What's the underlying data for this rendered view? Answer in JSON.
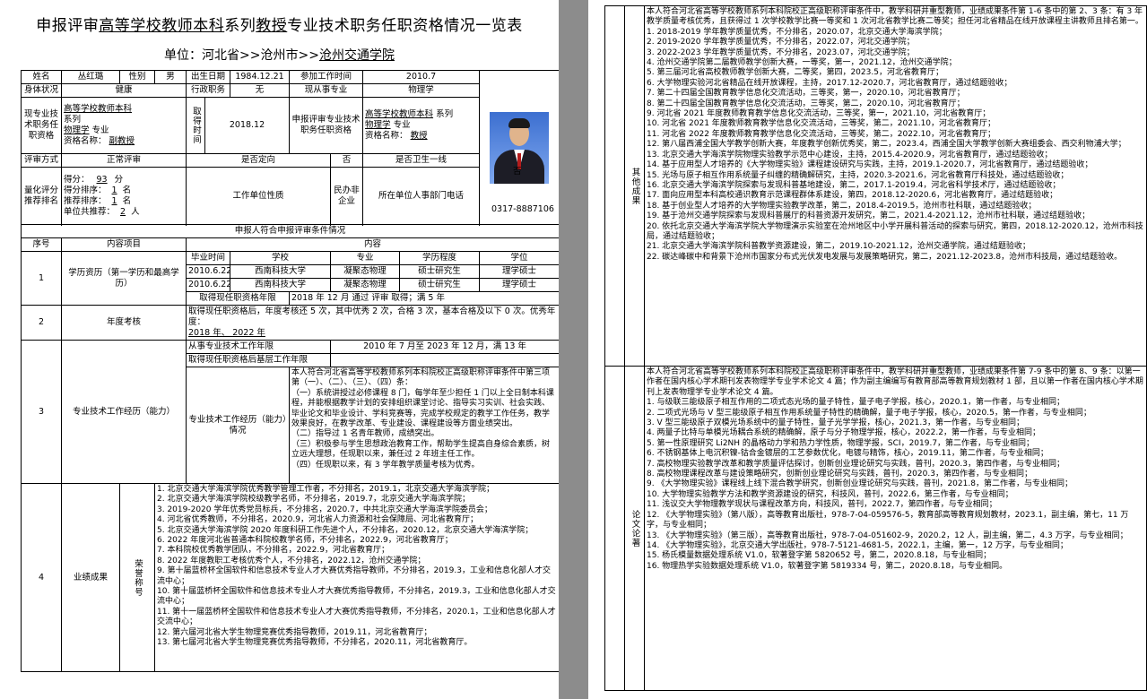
{
  "header": {
    "title_prefix": "申报评审",
    "title_field1": "高等学校教师本科",
    "title_mid1": "系列",
    "title_field2": "教授",
    "title_suffix": "专业技术职务任职资格情况一览表",
    "unit_label": "单位：河北省>>沧州市>>",
    "unit_name": "沧州交通学院"
  },
  "basic": {
    "name_label": "姓名",
    "name": "丛红璐",
    "sex_label": "性别",
    "sex": "男",
    "birth_label": "出生日期",
    "birth": "1984.12.21",
    "work_label": "参加工作时间",
    "work": "2010.7",
    "health_label": "身体状况",
    "health": "健康",
    "admin_label": "行政职务",
    "admin": "无",
    "major_label": "现从事专业",
    "major": "物理学",
    "cur_label": "现专业技术职务任职资格",
    "cur_line1": "高等学校教师本科",
    "cur_line2": "系列",
    "cur_line3a": "物理学",
    "cur_line3b": "专业",
    "cur_line4a": "资格名称：",
    "cur_line4b": "副教授",
    "get_label": "取得时间",
    "get_date": "2018.12",
    "apply_label": "申报评审专业技术职务任职资格",
    "apply_line1": "高等学校教师本科",
    "apply_line1b": "系列",
    "apply_line2a": "物理学",
    "apply_line2b": "专业",
    "apply_line3a": "资格名称：",
    "apply_line3b": "教授"
  },
  "review": {
    "way_label": "评审方式",
    "way": "正常评审",
    "directed_label": "是否定向",
    "directed": "否",
    "health_line_label": "是否卫生一线",
    "health_line": "否",
    "rank_label": "量化评分推荐排名",
    "score_label": "得分：",
    "score": "93",
    "score_unit": "分",
    "rank_label2": "得分排序：",
    "rank": "1",
    "rank_unit": "名",
    "rec_label": "推荐排序：",
    "rec": "1",
    "rec_unit": "名",
    "total_label": "单位共推荐：",
    "total": "2",
    "total_unit": "人",
    "nature_label": "工作单位性质",
    "nature": "民办非企业",
    "phone_label": "所在单位人事部门电话",
    "phone": "0317-8887106"
  },
  "cond": {
    "section_title": "申报人符合申报评审条件情况",
    "seq_label": "序号",
    "item_label": "内容项目",
    "content_label": "内容",
    "edu_seq": "1",
    "edu_label": "学历资历（第一学历和最高学历）",
    "edu_headers": [
      "毕业时间",
      "学校",
      "专业",
      "学历程度",
      "学位"
    ],
    "edu_rows": [
      [
        "2010.6.22",
        "西南科技大学",
        "凝聚态物理",
        "硕士研究生",
        "理学硕士"
      ],
      [
        "2010.6.22",
        "西南科技大学",
        "凝聚态物理",
        "硕士研究生",
        "理学硕士"
      ]
    ],
    "limit_label": "取得现任职资格年限",
    "limit_text": "2018 年 12 月   通过  评审  取得；满  5  年",
    "annual_seq": "2",
    "annual_label": "年度考核",
    "annual_text1": "取得现任职资格后，年度考核还 5 次，其中优秀 2 次，合格 3 次，基本合格及以下 0 次。优秀年度：",
    "annual_text2": "2018 年、  2022 年",
    "ability_seq": "3",
    "ability_label": "专业技术工作经历（能力）",
    "years_label": "从事专业技术工作年限",
    "years_text": "2010 年  7 月至  2023  年  12  月，满  13  年",
    "years2_label": "取得现任职资格后基层工作年限",
    "years2_text": "",
    "exp_label": "专业技术工作经历（能力）情况",
    "exp_text": [
      "本人符合河北省高等学校教师系列本科院校正高级职称评审条件中第三项第（一）、（二）、（三）、（四）条：",
      "（一）系统讲授过必修课程 8 门，每学年至少担任 1 门以上全日制本科课程，并能根据教学计划的安排组织课堂讨论、指导实习实训、社会实践、毕业论文和毕业设计、学科竞赛等，完成学校规定的教学工作任务，教学效果良好，在教学改革、专业建设、课程建设等方面业绩突出。",
      "（二）指导过 1 名青年教师，成绩突出。",
      "（三）积极参与学生思想政治教育工作，帮助学生提高自身综合素质，树立远大理想，任现职以来，兼任过 2 年班主任工作。",
      "（四）任现职以来，有 3 学年教学质量考核为优秀。"
    ],
    "perf_seq": "4",
    "perf_label": "业绩成果",
    "honor_label": "荣誉称号",
    "honors": [
      "1. 北京交通大学海滨学院优秀教学管理工作者，不分排名，2019.1，北京交通大学海滨学院；",
      "2. 北京交通大学海滨学院校级教学名师，不分排名，2019.7，北京交通大学海滨学院；",
      "3. 2019-2020 学年优秀党员标兵，不分排名，2020.7，中共北京交通大学海滨学院委员会；",
      "4. 河北省优秀教师，不分排名，2020.9，河北省人力资源和社会保障局、河北省教育厅；",
      "5. 北京交通大学海滨学院 2020 年度科研工作先进个人，不分排名，2020.12，北京交通大学海滨学院；",
      "6. 2022 年度河北省普通本科院校教学名师，不分排名，2022.9，河北省教育厅；",
      "7. 本科院校优秀教学团队，不分排名，2022.9，河北省教育厅；",
      "8. 2022 年度教职工考核优秀个人，不分排名，2022.12，沧州交通学院；",
      "9. 第十届蓝桥杯全国软件和信息技术专业人才大赛优秀指导教师，不分排名，2019.3，工业和信息化部人才交流中心；",
      "10. 第十届蓝桥杯全国软件和信息技术专业人才大赛优秀指导教师，不分排名，2019.3，工业和信息化部人才交流中心；",
      "11. 第十一届蓝桥杯全国软件和信息技术专业人才大赛优秀指导教师，不分排名，2020.1，工业和信息化部人才交流中心；",
      "12. 第六届河北省大学生物理竞赛优秀指导教师，2019.11，河北省教育厅；",
      "13. 第七届河北省大学生物理竞赛优秀指导教师，不分排名，2020.11，河北省教育厅。"
    ]
  },
  "right": {
    "other_label": "其他成果",
    "other": [
      "本人符合河北省高等学校教师系列本科院校正高级职称评审条件中，教学科研并重型教师，业绩成果条件第 1-6 条中的第 2、3 条：有 3 年教学质量考核优秀，且获得过 1 次学校教学比赛一等奖和 1 次河北省教学比赛二等奖；担任河北省精品在线开放课程主讲教师且排名第一。",
      "1. 2018-2019 学年教学质量优秀，不分排名，2020.07，北京交通大学海滨学院；",
      "2. 2019-2020 学年教学质量优秀，不分排名，2022.07，河北交通学院；",
      "3. 2022-2023 学年教学质量优秀，不分排名，2023.07，河北交通学院；",
      "4. 沧州交通学院第二届教师教学创新大赛，一等奖，第一，2021.12，沧州交通学院；",
      "5. 第三届河北省高校教师教学创新大赛，二等奖，第四，2023.5，河北省教育厅；",
      "6. 大学物理实验河北省精品在线开放课程，主持，2017.12-2020.7，河北省教育厅，通过结题验收；",
      "7. 第二十四届全国教育教学信息化交流活动，三等奖，第一，2020.10，河北省教育厅；",
      "8. 第二十四届全国教育教学信息化交流活动，三等奖，第二，2020.10，河北省教育厅；",
      "9. 河北省 2021 年度教师教育教学信息化交流活动，三等奖，第一，2021.10，河北省教育厅；",
      "10. 河北省 2021 年度教师教育教学信息化交流活动，三等奖，第二，2021.10，河北省教育厅；",
      "11. 河北省 2022 年度教师教育教学信息化交流活动，三等奖，第二，2022.10，河北省教育厅；",
      "12. 第八届西浦全国大学教学创新大赛，年度教学创新优秀奖，第二，2023.4，西浦全国大学教学创新大赛组委会、西交利物浦大学；",
      "13. 北京交通大学海滨学院物理实验教学示范中心建设，主持，2015.4-2020.9，河北省教育厅，通过结题验收；",
      "14. 基于应用型人才培养的《大学物理实验》课程建设研究与实践，主持，2019.1-2020.7，河北省教育厅，通过结题验收；",
      "15. 光场与原子相互作用系统量子纠缠的精确解研究，主持，2020.3-2021.6，河北省教育厅科技处，通过结题验收；",
      "16. 北京交通大学海滨学院探索与发现科普基地建设，第二，2017.1-2019.4，河北省科学技术厅，通过结题验收；",
      "17. 面向应用型本科高校通识教育示范课程群体系建设，第四，2018.12-2020.6，河北省教育厅，通过结题验收；",
      "18. 基于创业型人才培养的大学物理实验教学改革，第二，2018.4-2019.5，沧州市社科联，通过结题验收；",
      "19. 基于沧州交通学院探索与发现科普展厅的科普资源开发研究，第二，2021.4-2021.12，沧州市社科联，通过结题验收；",
      "20. 依托北京交通大学海滨学院大学物理演示实验室在沧州地区中小学开展科普活动的探索与研究，第四，2018.12-2020.12，沧州市科技局，通过结题验收；",
      "21. 北京交通大学海滨学院科普教学资源建设，第二，2019.10-2021.12，沧州交通学院，通过结题验收；",
      "22. 碳达峰碳中和背景下沧州市国家分布式光伏发电发展与发展策略研究，第二，2021.12-2023.8，沧州市科技局，通过结题验收。"
    ],
    "paper_label": "论文论著",
    "papers": [
      "本人符合河北省高等学校教师系列本科院校正高级职称评审条件中，教学科研并重型教师，业绩成果条件第 7-9 条中的第 8、9 条：以第一作者在国内核心学术期刊发表物理学专业学术论文 4 篇；作为副主编编写有教育部高等教育规划教材 1 部，且以第一作者在国内核心学术期刊上发表物理学专业学术论文 4 篇。",
      "1. 与级联三能级原子相互作用的二项式态光场的量子特性，量子电子学报，核心，2020.1，第一作者，与专业相同；",
      "2. 二项式光场与 V 型三能级原子相互作用系统量子特性的精确解，量子电子学报，核心，2020.5，第一作者，与专业相同；",
      "3. V 型三能级原子双模光场系统中的量子特性，量子光学学报，核心，2021.3，第一作者，与专业相同；",
      "4. 两量子比特与单模光场耦合系统的精确解，原子与分子物理学报，核心，2022.2，第一作者，与专业相同；",
      "5. 第一性原理研究 Li2NH 的晶格动力学和热力学性质，物理学报，SCI，2019.7，第二作者，与专业相同；",
      "6. 不锈钢基体上电沉积镍-钴合金镀层的工艺参数优化，电镀与精饰，核心，2019.11，第二作者，与专业相同；",
      "7. 高校物理实验教学改革和教学质量评估探讨，创新创业理论研究与实践，普刊，2020.3，第四作者，与专业相同；",
      "8. 高校物理课程改革与建设策略研究，创新创业理论研究与实践，普刊，2020.3，第四作者，与专业相同；",
      "9. 《大学物理实验》课程线上线下混合教学研究，创新创业理论研究与实践，普刊，2021.8，第二作者，与专业相同；",
      "10. 大学物理实验教学方法和教学资源建设的研究，科技风，普刊，2022.6，第三作者，与专业相同；",
      "11. 浅议交大学物理教学现状与课程改革方向，科技风，普刊，2022.7，第四作者，与专业相同；",
      "12. 《大学物理实验》（第八版），高等教育出版社，978-7-04-059576-5，教育部高等教育规划教材，2023.1，副主编，第七，11 万字，与专业相同；",
      "13. 《大学物理实验》（第三版），高等教育出版社，978-7-04-051602-9，2020.2，12 人，副主编，第二，4.3 万字，与专业相同；",
      "14. 《大学物理实验》，北京交通大学出版社，978-7-5121-4681-5，2022.1，主编，第一，12 万字，与专业相同；",
      "15. 杨氏模量数据处理系统 V1.0，软著登字第 5820652 号，第二，2020.8.18，与专业相同；",
      "16. 物理热学实验数据处理系统 V1.0，软著登字第 5819334 号，第二，2020.8.18，与专业相同。"
    ]
  }
}
